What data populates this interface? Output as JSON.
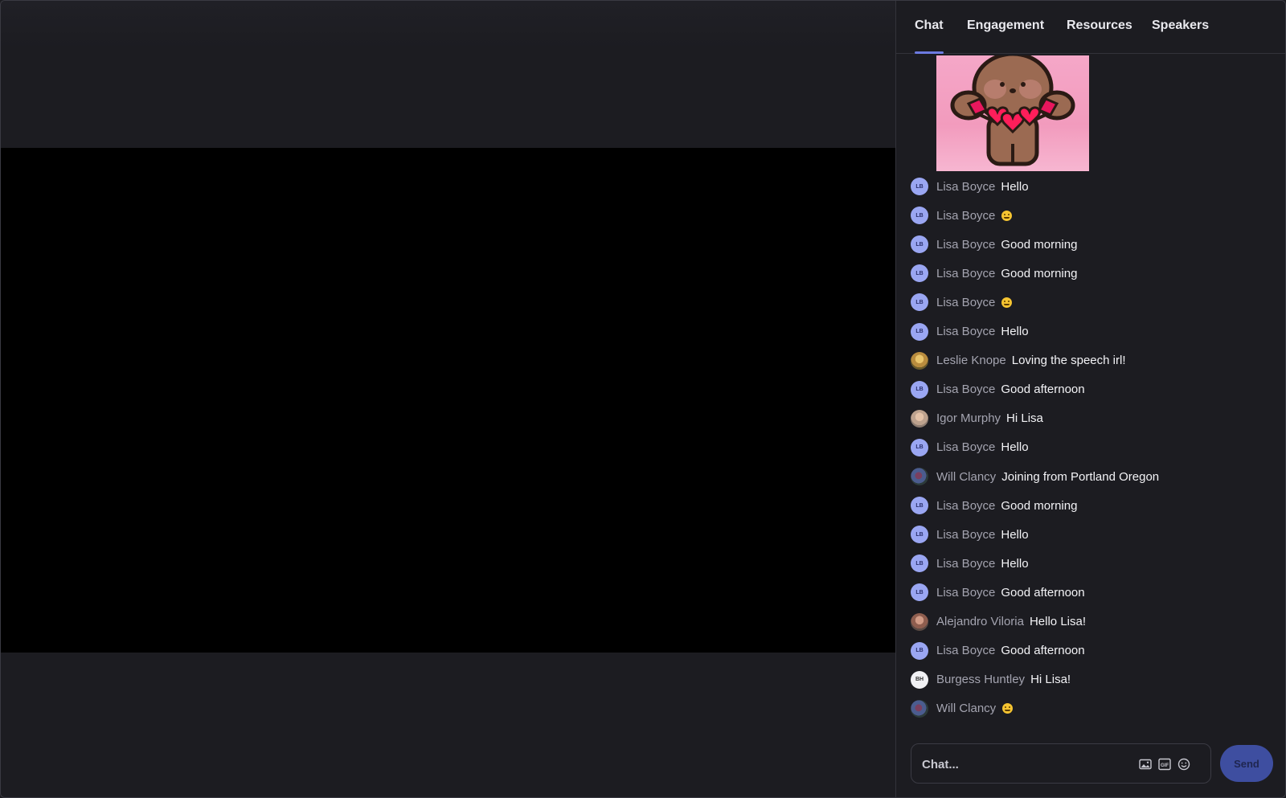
{
  "tabs": [
    {
      "label": "Chat",
      "active": true
    },
    {
      "label": "Engagement",
      "active": false
    },
    {
      "label": "Resources",
      "active": false
    },
    {
      "label": "Speakers",
      "active": false
    }
  ],
  "sticker": {
    "icon": "bear-hearts-sticker"
  },
  "messages": [
    {
      "sender": "Lisa Boyce",
      "initials": "LB",
      "text": "Hello",
      "emoji": false
    },
    {
      "sender": "Lisa Boyce",
      "initials": "LB",
      "text": "",
      "emoji": true
    },
    {
      "sender": "Lisa Boyce",
      "initials": "LB",
      "text": "Good morning",
      "emoji": false
    },
    {
      "sender": "Lisa Boyce",
      "initials": "LB",
      "text": "Good morning",
      "emoji": false
    },
    {
      "sender": "Lisa Boyce",
      "initials": "LB",
      "text": "",
      "emoji": true
    },
    {
      "sender": "Lisa Boyce",
      "initials": "LB",
      "text": "Hello",
      "emoji": false
    },
    {
      "sender": "Leslie Knope",
      "initials": "",
      "text": "Loving the speech irl!",
      "emoji": false
    },
    {
      "sender": "Lisa Boyce",
      "initials": "LB",
      "text": "Good afternoon",
      "emoji": false
    },
    {
      "sender": "Igor Murphy",
      "initials": "",
      "text": "Hi Lisa",
      "emoji": false
    },
    {
      "sender": "Lisa Boyce",
      "initials": "LB",
      "text": "Hello",
      "emoji": false
    },
    {
      "sender": "Will Clancy",
      "initials": "",
      "text": "Joining from Portland Oregon",
      "emoji": false
    },
    {
      "sender": "Lisa Boyce",
      "initials": "LB",
      "text": "Good morning",
      "emoji": false
    },
    {
      "sender": "Lisa Boyce",
      "initials": "LB",
      "text": "Hello",
      "emoji": false
    },
    {
      "sender": "Lisa Boyce",
      "initials": "LB",
      "text": "Hello",
      "emoji": false
    },
    {
      "sender": "Lisa Boyce",
      "initials": "LB",
      "text": "Good afternoon",
      "emoji": false
    },
    {
      "sender": "Alejandro Viloria",
      "initials": "",
      "text": "Hello Lisa!",
      "emoji": false
    },
    {
      "sender": "Lisa Boyce",
      "initials": "LB",
      "text": "Good afternoon",
      "emoji": false
    },
    {
      "sender": "Burgess Huntley",
      "initials": "BH",
      "text": "Hi Lisa!",
      "emoji": false
    },
    {
      "sender": "Will Clancy",
      "initials": "",
      "text": "",
      "emoji": true
    }
  ],
  "composer": {
    "placeholder": "Chat...",
    "image_icon": "image-icon",
    "gif_icon": "gif-icon",
    "gif_label": "GIF",
    "emoji_icon": "emoji-icon",
    "send_label": "Send"
  },
  "colors": {
    "accent": "#6c7ae0",
    "send": "#3e4ea0",
    "avatar": "#9aa6f2"
  }
}
